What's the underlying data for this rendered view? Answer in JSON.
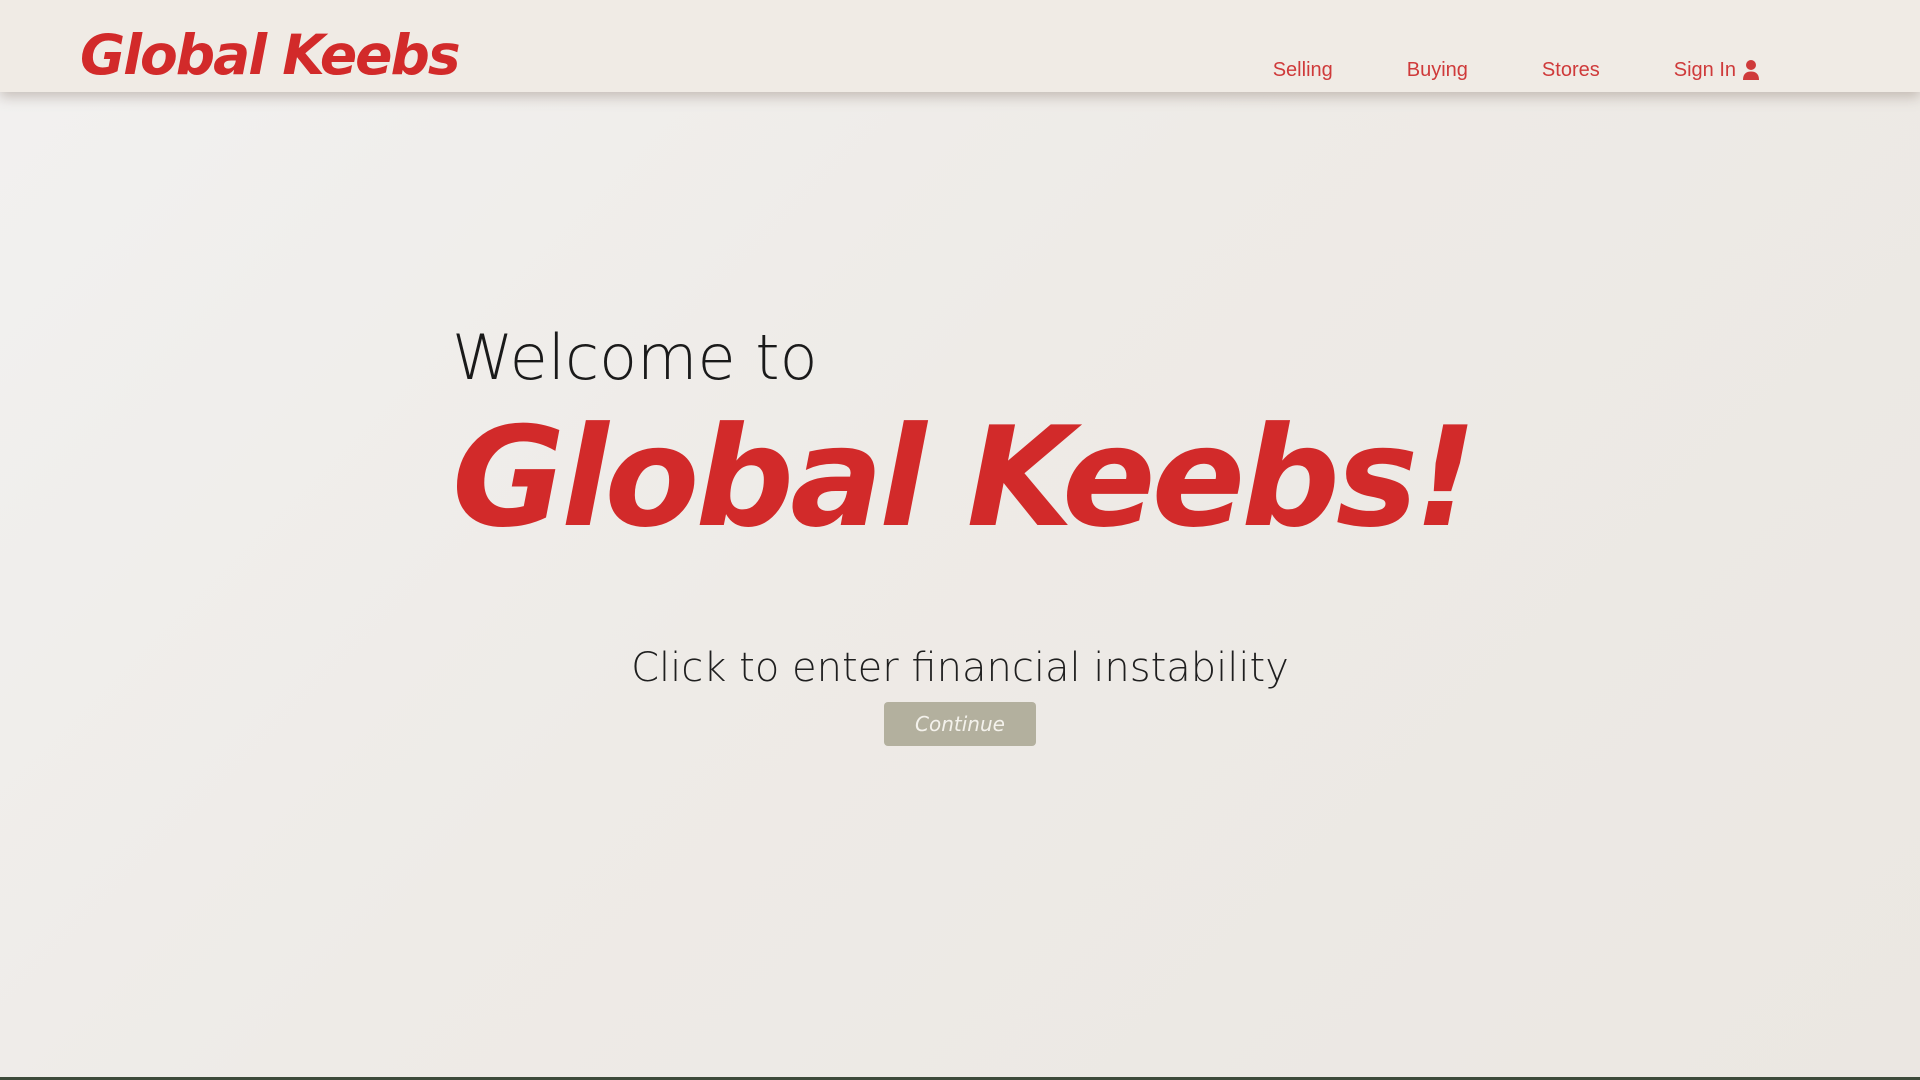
{
  "header": {
    "brand": "Global Keebs",
    "nav": {
      "selling": "Selling",
      "buying": "Buying",
      "stores": "Stores",
      "sign_in": "Sign In"
    },
    "sign_in_icon": "user-icon"
  },
  "hero": {
    "welcome": "Welcome to",
    "title": "Global Keebs!",
    "tagline": "Click to enter financial instability",
    "continue_label": "Continue"
  },
  "colors": {
    "brand_red": "#d22a2a",
    "nav_red": "#cf3a3a",
    "button_bg": "#b3b09e",
    "header_bg": "#f0ebe5"
  }
}
